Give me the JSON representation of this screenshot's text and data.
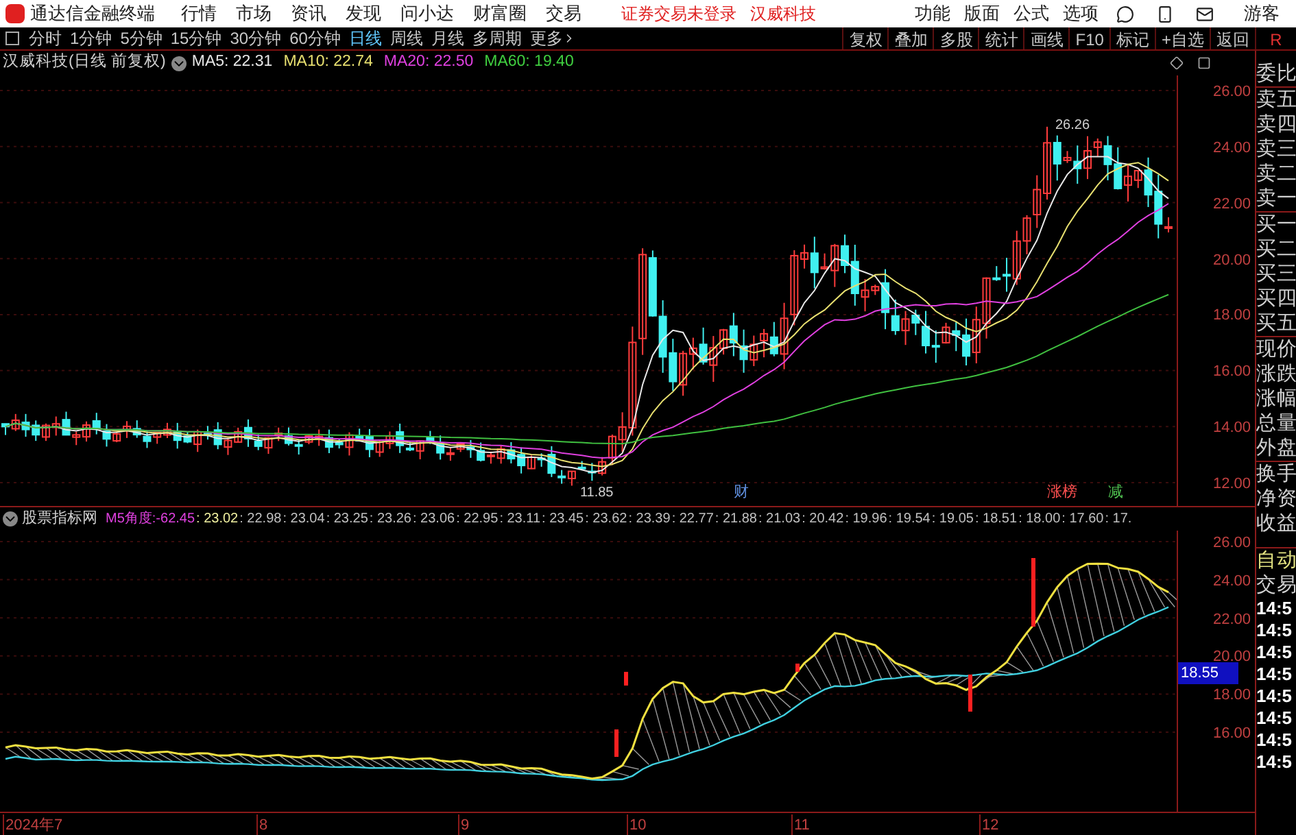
{
  "title_bar": {
    "app_name": "通达信金融终端",
    "menu": [
      "行情",
      "市场",
      "资讯",
      "发现",
      "问小达",
      "财富圈",
      "交易"
    ],
    "status": [
      "证券交易未登录",
      "汉威科技"
    ],
    "right_menu": [
      "功能",
      "版面",
      "公式",
      "选项"
    ],
    "user": "游客"
  },
  "toolbar": {
    "periods": [
      {
        "label": "分时",
        "selected": false
      },
      {
        "label": "1分钟",
        "selected": false
      },
      {
        "label": "5分钟",
        "selected": false
      },
      {
        "label": "15分钟",
        "selected": false
      },
      {
        "label": "30分钟",
        "selected": false
      },
      {
        "label": "60分钟",
        "selected": false
      },
      {
        "label": "日线",
        "selected": true
      },
      {
        "label": "周线",
        "selected": false
      },
      {
        "label": "月线",
        "selected": false
      },
      {
        "label": "多周期",
        "selected": false
      },
      {
        "label": "更多",
        "selected": false
      }
    ],
    "buttons": [
      "复权",
      "叠加",
      "多股",
      "统计",
      "画线",
      "F10",
      "标记",
      "+自选",
      "返回"
    ],
    "corner": "R"
  },
  "main_chart": {
    "title": "汉威科技(日线 前复权)",
    "ma": [
      {
        "label": "MA5: 22.31",
        "color": "#e8e8e8"
      },
      {
        "label": "MA10: 22.74",
        "color": "#e8e070"
      },
      {
        "label": "MA20: 22.50",
        "color": "#e040e0"
      },
      {
        "label": "MA60: 19.40",
        "color": "#40d040"
      }
    ],
    "y_ticks": [
      "26.00",
      "24.00",
      "22.00",
      "20.00",
      "18.00",
      "16.00",
      "14.00",
      "12.00"
    ],
    "high_label": "26.26",
    "low_label": "11.85",
    "markers": [
      {
        "label": "财",
        "color": "#6090e0"
      },
      {
        "label": "涨榜",
        "color": "#ff5050"
      },
      {
        "label": "减",
        "color": "#50c050"
      }
    ]
  },
  "indicator": {
    "title": "股票指标网",
    "name": "M5角度:",
    "value": "-62.45",
    "readings": [
      ": 23.02",
      ": 22.98",
      ": 23.04",
      ": 23.25",
      ": 23.26",
      ": 23.06",
      ": 22.95",
      ": 23.11",
      ": 23.45",
      ": 23.62",
      ": 23.39",
      ": 22.77",
      ": 21.88",
      ": 21.03",
      ": 20.42",
      ": 19.96",
      ": 19.54",
      ": 19.05",
      ": 18.51",
      ": 18.00",
      ": 17.60",
      ": 17."
    ],
    "y_ticks": [
      "26.00",
      "24.00",
      "22.00",
      "20.00",
      "18.00",
      "16.00"
    ],
    "current": "18.55"
  },
  "x_axis": [
    "2024年7",
    "8",
    "9",
    "10",
    "11",
    "12"
  ],
  "quote_panel": {
    "labels": [
      "委比",
      "卖五",
      "卖四",
      "卖三",
      "卖二",
      "卖一",
      "买一",
      "买二",
      "买三",
      "买四",
      "买五",
      "现价",
      "涨跌",
      "涨幅",
      "总量",
      "外盘",
      "换手",
      "净资",
      "收益"
    ],
    "mode": "自动",
    "trade_header": "交易",
    "times": [
      "14:5",
      "14:5",
      "14:5",
      "14:5",
      "14:5",
      "14:5",
      "14:5",
      "14:5"
    ]
  }
}
